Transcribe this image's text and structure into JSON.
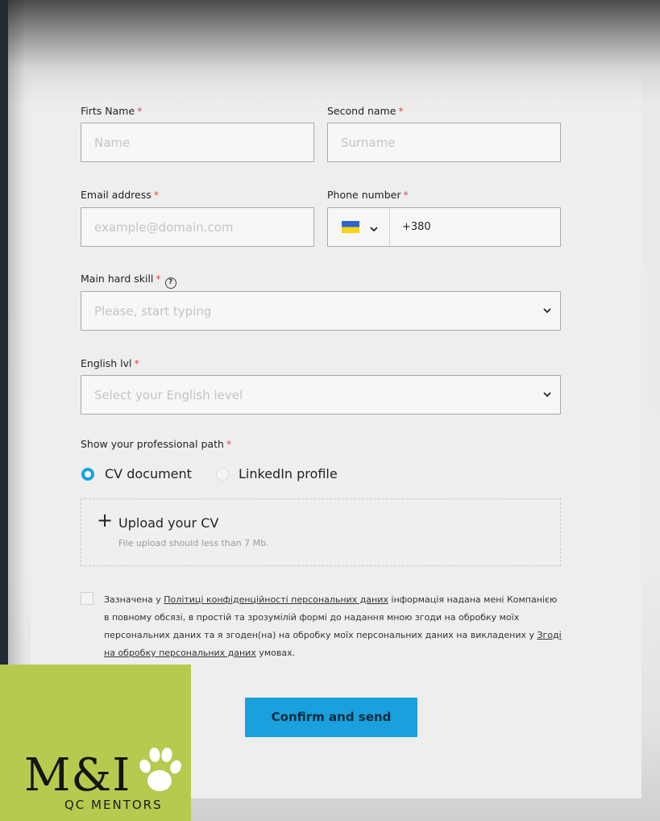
{
  "form": {
    "first_name": {
      "label": "Firts Name",
      "required": "*",
      "placeholder": "Name"
    },
    "second_name": {
      "label": "Second name",
      "required": "*",
      "placeholder": "Surname"
    },
    "email": {
      "label": "Email address",
      "required": "*",
      "placeholder": "example@domain.com"
    },
    "phone": {
      "label": "Phone number",
      "required": "*",
      "value": "+380",
      "flag": "ukraine-flag-icon"
    },
    "hard_skill": {
      "label": "Main hard skill",
      "required": "*",
      "help": "?",
      "placeholder": "Please, start typing"
    },
    "english": {
      "label": "English lvl",
      "required": "*",
      "placeholder": "Select your English level"
    },
    "path": {
      "label": "Show your professional path",
      "required": "*",
      "options": [
        {
          "label": "CV document",
          "selected": true
        },
        {
          "label": "LinkedIn profile",
          "selected": false
        }
      ]
    },
    "upload": {
      "plus": "+",
      "title": "Upload your CV",
      "hint": "File upload should less than 7 Mb."
    },
    "consent": {
      "part1": "Зазначена у ",
      "link1": "Політиці конфіденційності персональних даних",
      "part2": " інформація надана мені Компанією в повному обсязі, в простій та зрозумілій формі до надання мною згоди на обробку моїх персональних даних та я згоден(на) на обробку моїх персональних даних на викладених у ",
      "link2": "Згоді на обробку персональних даних",
      "part3": " умовах."
    },
    "submit_label": "Confirm and send"
  },
  "watermark": {
    "logo": "M&I",
    "subtitle": "QC MENTORS",
    "icon": "paw-icon",
    "bg_color": "#b5cb4f"
  },
  "colors": {
    "accent": "#1aa0dc",
    "required": "#e5484d"
  }
}
